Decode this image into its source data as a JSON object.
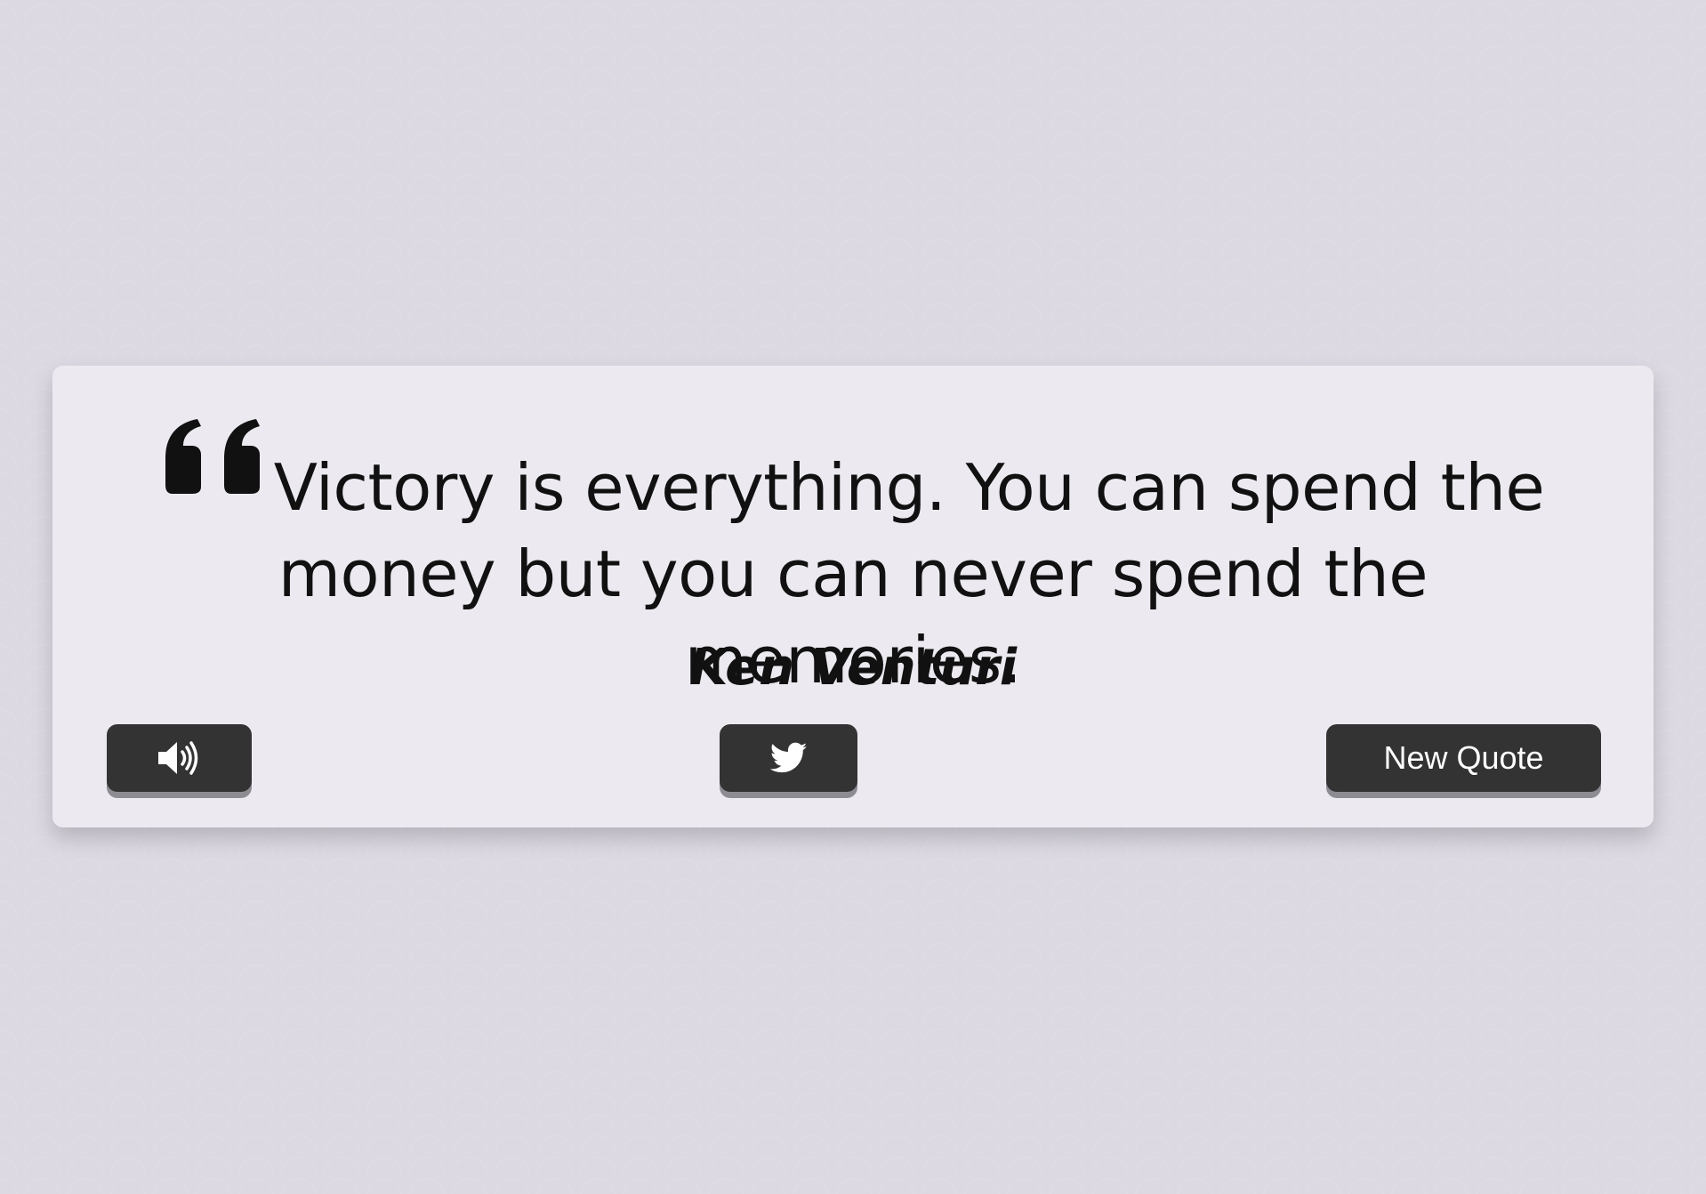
{
  "quote": {
    "text": "Victory is everything. You can spend the money but you can never spend the memories.",
    "author": "Ken Venturi",
    "quote_icon": "quote-left-icon"
  },
  "controls": {
    "speak_icon": "volume-up-icon",
    "tweet_icon": "twitter-icon",
    "new_quote_label": "New Quote"
  },
  "colors": {
    "background": "#dcd9e3",
    "card": "#eeecf1",
    "text": "#111111",
    "button": "#333333",
    "button_text": "#ffffff",
    "button_shadow": "#8e8c93"
  }
}
